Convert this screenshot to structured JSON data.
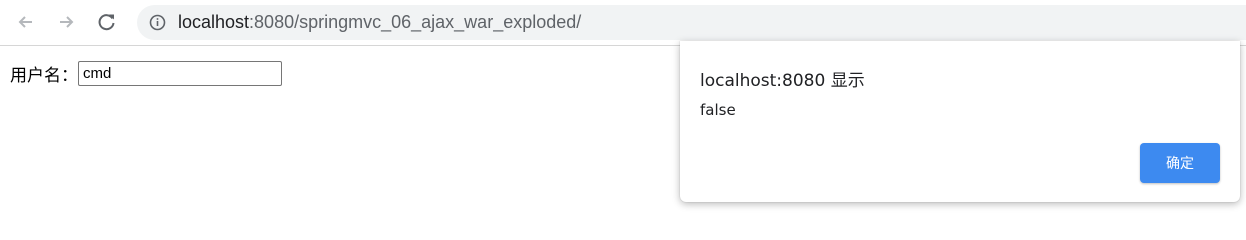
{
  "browser": {
    "url_host": "localhost",
    "url_rest": ":8080/springmvc_06_ajax_war_exploded/",
    "icons": [
      "back-arrow-icon",
      "forward-arrow-icon",
      "reload-icon",
      "info-icon"
    ]
  },
  "form": {
    "label": "用户名：",
    "username_value": "cmd"
  },
  "dialog": {
    "title": "localhost:8080 显示",
    "message": "false",
    "ok_label": "确定",
    "ok_color": "#3d8af0"
  }
}
